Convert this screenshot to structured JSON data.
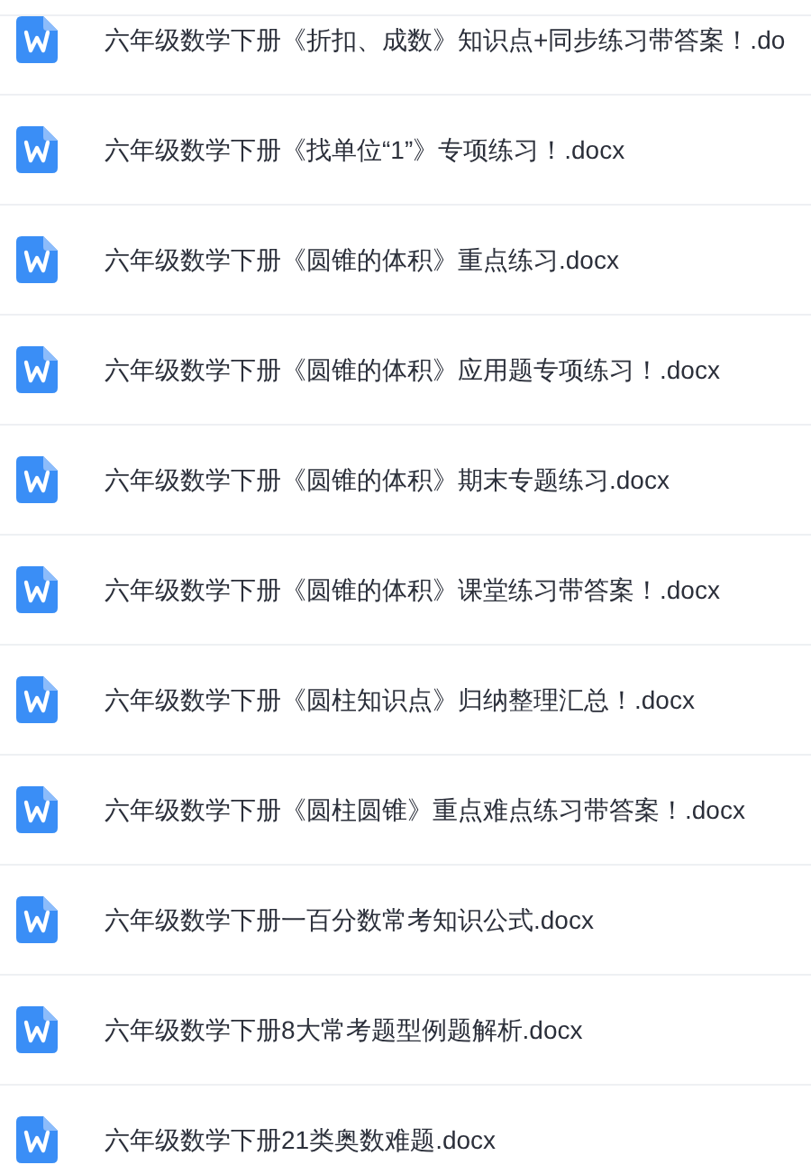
{
  "files": [
    {
      "name": "六年级数学下册《折扣、成数》知识点+同步练习带答案！.do"
    },
    {
      "name": "六年级数学下册《找单位“1”》专项练习！.docx"
    },
    {
      "name": "六年级数学下册《圆锥的体积》重点练习.docx"
    },
    {
      "name": "六年级数学下册《圆锥的体积》应用题专项练习！.docx"
    },
    {
      "name": "六年级数学下册《圆锥的体积》期末专题练习.docx"
    },
    {
      "name": "六年级数学下册《圆锥的体积》课堂练习带答案！.docx"
    },
    {
      "name": "六年级数学下册《圆柱知识点》归纳整理汇总！.docx"
    },
    {
      "name": "六年级数学下册《圆柱圆锥》重点难点练习带答案！.docx"
    },
    {
      "name": "六年级数学下册一百分数常考知识公式.docx"
    },
    {
      "name": "六年级数学下册8大常考题型例题解析.docx"
    },
    {
      "name": "六年级数学下册21类奥数难题.docx"
    }
  ]
}
